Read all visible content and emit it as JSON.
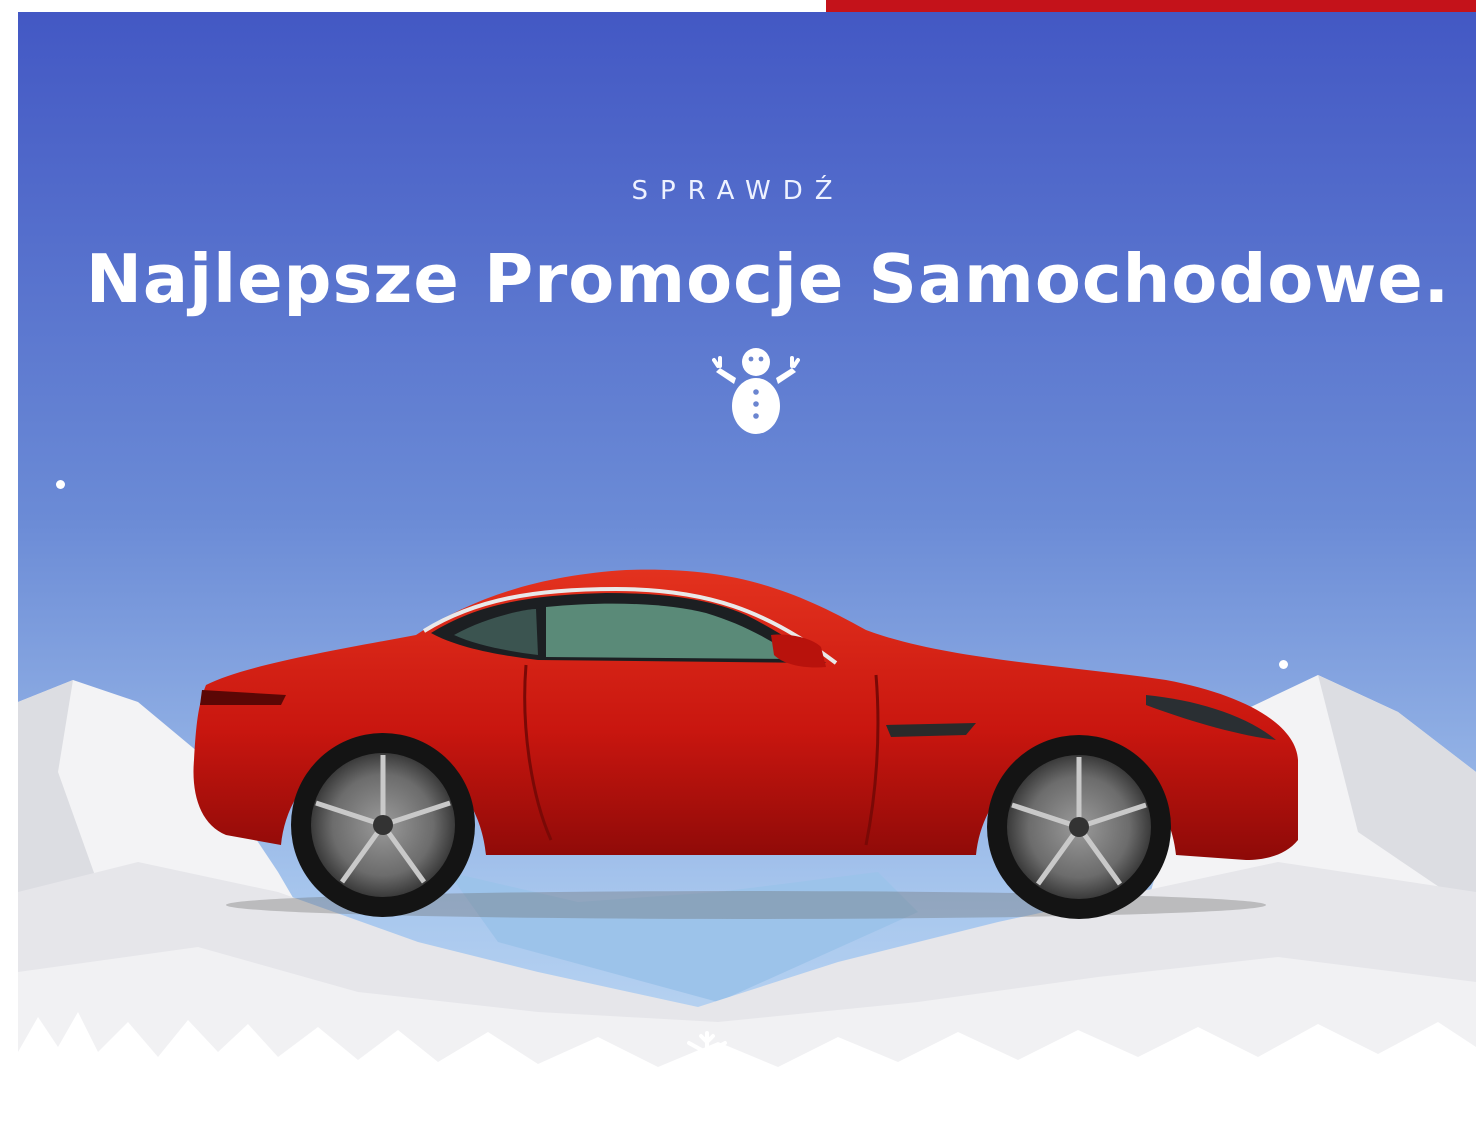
{
  "hero": {
    "eyebrow": "SPRAWDŹ",
    "headline": "Najlepsze Promocje Samochodowe.",
    "icons": {
      "mascot": "snowman-icon",
      "decoration": "snowflake-icon"
    }
  },
  "colors": {
    "accent_red": "#c4121a",
    "sky_top": "#4358c4",
    "sky_bottom": "#a9c8ee",
    "snow": "#eeeeee",
    "car_body": "#cf1d14"
  }
}
